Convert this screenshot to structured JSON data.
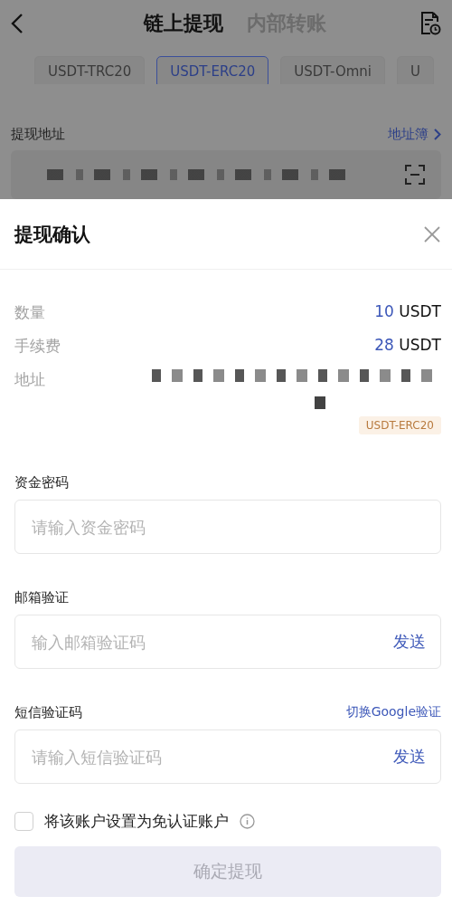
{
  "header": {
    "tabs": [
      {
        "label": "链上提现",
        "selected": true
      },
      {
        "label": "内部转账",
        "selected": false
      }
    ]
  },
  "chains": [
    {
      "label": "USDT-TRC20",
      "selected": false
    },
    {
      "label": "USDT-ERC20",
      "selected": true
    },
    {
      "label": "USDT-Omni",
      "selected": false
    },
    {
      "label": "U",
      "selected": false
    }
  ],
  "address_section": {
    "label": "提现地址",
    "link": "地址簿"
  },
  "sheet": {
    "title": "提现确认",
    "summary": [
      {
        "label": "数量",
        "amount": "10",
        "unit": "USDT"
      },
      {
        "label": "手续费",
        "amount": "28",
        "unit": "USDT"
      }
    ],
    "address": {
      "label": "地址",
      "network": "USDT-ERC20"
    },
    "fields": [
      {
        "label": "资金密码",
        "placeholder": "请输入资金密码"
      },
      {
        "label": "邮箱验证",
        "placeholder": "输入邮箱验证码",
        "action": "发送"
      },
      {
        "label": "短信验证码",
        "label_link": "切换Google验证",
        "placeholder": "请输入短信验证码",
        "action": "发送"
      }
    ],
    "exempt": {
      "label": "将该账户设置为免认证账户",
      "checked": false
    },
    "submit": {
      "label": "确定提现",
      "disabled": true
    }
  }
}
